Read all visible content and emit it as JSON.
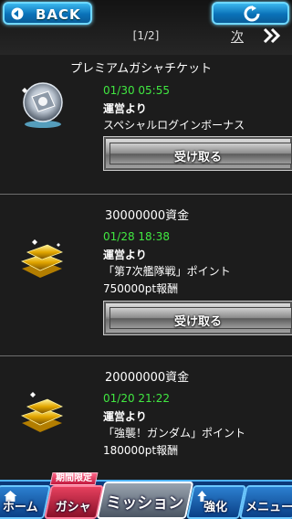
{
  "header": {
    "back_label": "BACK",
    "back_icon": "back-arrow-icon",
    "refresh_icon": "refresh-icon",
    "pager_text": "[1/2]",
    "next_label": "次",
    "next_icon": "double-chevron-right-icon",
    "accent_color": "#0a71b8"
  },
  "items": [
    {
      "title": "プレミアムガシャチケット",
      "icon": "premium-gacha-ticket-icon",
      "date": "01/30 05:55",
      "sender": "運営より",
      "line1": "スペシャルログインボーナス",
      "line2": "",
      "button_label": "受け取る"
    },
    {
      "title": "30000000資金",
      "icon": "gold-bars-icon",
      "date": "01/28 18:38",
      "sender": "運営より",
      "line1": "「第7次艦隊戦」ポイント",
      "line2": "750000pt報酬",
      "button_label": "受け取る"
    },
    {
      "title": "20000000資金",
      "icon": "gold-bars-icon",
      "date": "01/20 21:22",
      "sender": "運営より",
      "line1": "「強襲！ガンダム」ポイント",
      "line2": "180000pt報酬",
      "button_label": ""
    }
  ],
  "nav": {
    "home": "ホーム",
    "gacha": "ガシャ",
    "gacha_badge": "期間限定",
    "mission": "ミッション",
    "enhance": "強化",
    "menu": "メニュー",
    "active": "mission"
  }
}
